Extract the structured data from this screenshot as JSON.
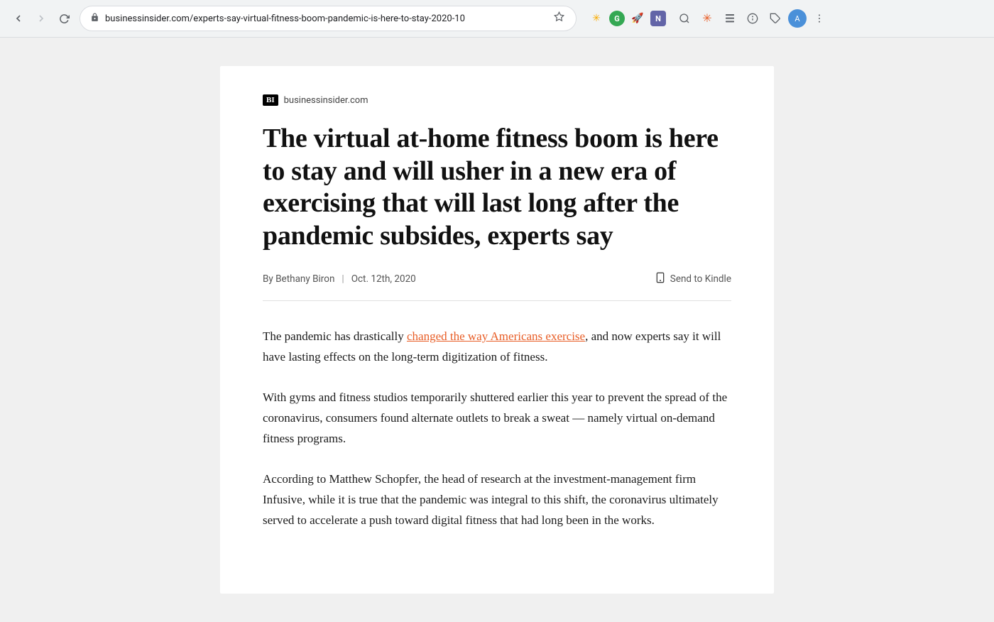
{
  "browser": {
    "url": "businessinsider.com/experts-say-virtual-fitness-boom-pandemic-is-here-to-stay-2020-10",
    "back_disabled": false,
    "forward_disabled": true
  },
  "source": {
    "logo": "BI",
    "domain": "businessinsider.com"
  },
  "article": {
    "title": "The virtual at-home fitness boom is here to stay and will usher in a new era of exercising that will last long after the pandemic subsides, experts say",
    "author": "By Bethany Biron",
    "date": "Oct. 12th, 2020",
    "send_to_kindle": "Send to Kindle",
    "paragraphs": [
      {
        "id": "p1",
        "text_before_link": "The pandemic has drastically ",
        "link_text": "changed the way Americans exercise",
        "text_after_link": ", and now experts say it will have lasting effects on the long-term digitization of fitness."
      },
      {
        "id": "p2",
        "text": "With gyms and fitness studios temporarily shuttered earlier this year to prevent the spread of the coronavirus, consumers found alternate outlets to break a sweat — namely virtual on-demand fitness programs."
      },
      {
        "id": "p3",
        "text": "According to Matthew Schopfer, the head of research at the investment-management firm Infusive, while it is true that the pandemic was integral to this shift, the coronavirus ultimately served to accelerate a push toward digital fitness that had long been in the works."
      }
    ]
  }
}
